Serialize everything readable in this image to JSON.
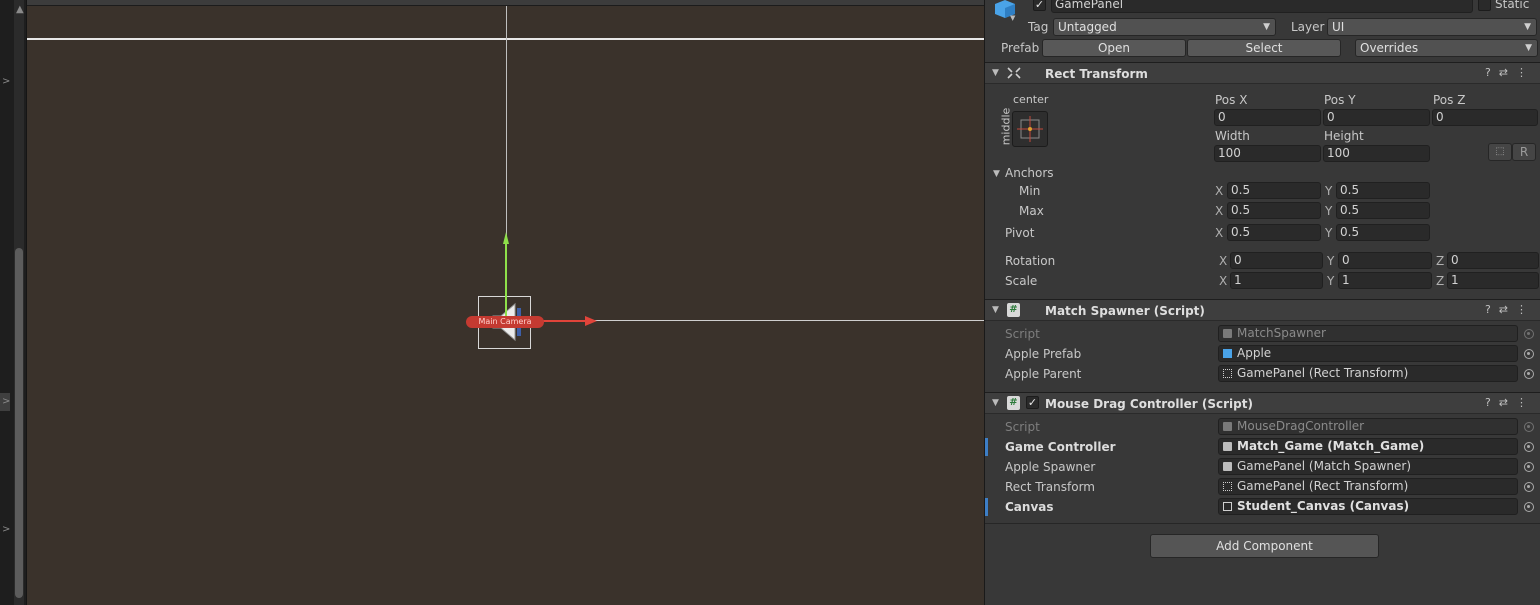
{
  "gameobject": {
    "name": "GamePanel",
    "static_label": "Static",
    "tag_label": "Tag",
    "tag_value": "Untagged",
    "layer_label": "Layer",
    "layer_value": "UI",
    "prefab_label": "Prefab",
    "open_label": "Open",
    "select_label": "Select",
    "overrides_label": "Overrides"
  },
  "scene": {
    "object_label": "Main Camera"
  },
  "rect_transform": {
    "title": "Rect Transform",
    "anchor_h": "center",
    "anchor_v": "middle",
    "pos_x_label": "Pos X",
    "pos_x": "0",
    "pos_y_label": "Pos Y",
    "pos_y": "0",
    "pos_z_label": "Pos Z",
    "pos_z": "0",
    "width_label": "Width",
    "width": "100",
    "height_label": "Height",
    "height": "100",
    "r_button": "R",
    "anchors_label": "Anchors",
    "min_label": "Min",
    "min_x": "0.5",
    "min_y": "0.5",
    "max_label": "Max",
    "max_x": "0.5",
    "max_y": "0.5",
    "pivot_label": "Pivot",
    "pivot_x": "0.5",
    "pivot_y": "0.5",
    "rotation_label": "Rotation",
    "rot_x": "0",
    "rot_y": "0",
    "rot_z": "0",
    "scale_label": "Scale",
    "scale_x": "1",
    "scale_y": "1",
    "scale_z": "1",
    "x": "X",
    "y": "Y",
    "z": "Z"
  },
  "match_spawner": {
    "title": "Match Spawner (Script)",
    "script_label": "Script",
    "script_value": "MatchSpawner",
    "apple_prefab_label": "Apple Prefab",
    "apple_prefab_value": "Apple",
    "apple_parent_label": "Apple Parent",
    "apple_parent_value": "GamePanel (Rect Transform)"
  },
  "mouse_drag": {
    "title": "Mouse Drag Controller (Script)",
    "script_label": "Script",
    "script_value": "MouseDragController",
    "game_controller_label": "Game Controller",
    "game_controller_value": "Match_Game (Match_Game)",
    "apple_spawner_label": "Apple Spawner",
    "apple_spawner_value": "GamePanel (Match Spawner)",
    "rect_transform_label": "Rect Transform",
    "rect_transform_value": "GamePanel (Rect Transform)",
    "canvas_label": "Canvas",
    "canvas_value": "Student_Canvas (Canvas)"
  },
  "add_component_label": "Add Component",
  "colors": {
    "scene_bg": "#3a322b",
    "inspector_bg": "#383838",
    "accent_blue": "#3d7ec6",
    "gizmo_y": "#8ee04a",
    "gizmo_x": "#e0443a"
  }
}
